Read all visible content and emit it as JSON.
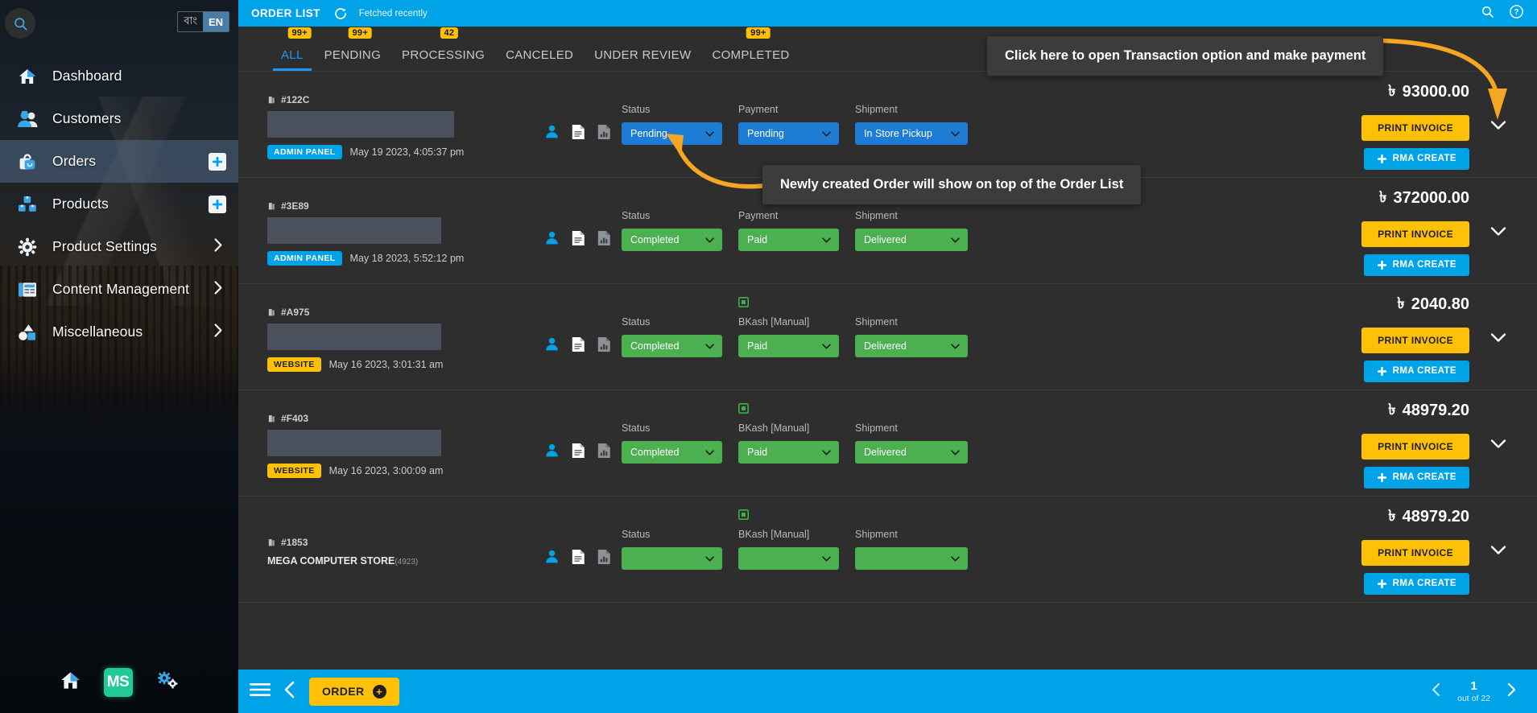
{
  "sidebar": {
    "search_icon": "search-icon",
    "lang": {
      "bn": "বাং",
      "en": "EN",
      "active": "EN"
    },
    "items": [
      {
        "label": "Dashboard",
        "icon": "home-icon",
        "active": false,
        "affix": "none"
      },
      {
        "label": "Customers",
        "icon": "users-icon",
        "active": false,
        "affix": "none"
      },
      {
        "label": "Orders",
        "icon": "bag-icon",
        "active": true,
        "affix": "plus"
      },
      {
        "label": "Products",
        "icon": "boxes-icon",
        "active": false,
        "affix": "plus"
      },
      {
        "label": "Product Settings",
        "icon": "gear-icon",
        "active": false,
        "affix": "chevron"
      },
      {
        "label": "Content Management",
        "icon": "newspaper-icon",
        "active": false,
        "affix": "chevron"
      },
      {
        "label": "Miscellaneous",
        "icon": "shapes-icon",
        "active": false,
        "affix": "chevron"
      }
    ],
    "footer": {
      "home_icon": "home-icon",
      "logo_text": "MS",
      "settings_icon": "gears-icon"
    }
  },
  "topbar": {
    "title": "ORDER LIST",
    "refresh_icon": "refresh-icon",
    "fetched": "Fetched recently",
    "search_icon": "search-icon",
    "help_icon": "help-circle-icon",
    "accent": "#00a3e8"
  },
  "tabs": [
    {
      "label": "ALL",
      "badge": "99+",
      "active": true
    },
    {
      "label": "PENDING",
      "badge": "99+",
      "active": false
    },
    {
      "label": "PROCESSING",
      "badge": "42",
      "active": false
    },
    {
      "label": "CANCELED",
      "badge": "",
      "active": false
    },
    {
      "label": "UNDER REVIEW",
      "badge": "",
      "active": false
    },
    {
      "label": "COMPLETED",
      "badge": "99+",
      "active": false
    }
  ],
  "labels": {
    "status": "Status",
    "payment": "Payment",
    "shipment": "Shipment",
    "bkash_manual": "BKash [Manual]",
    "print_invoice": "PRINT INVOICE",
    "rma_create": "RMA CREATE",
    "taka": "৳"
  },
  "orders": [
    {
      "id": "#122C",
      "redacted_width": 232,
      "source": "ADMIN PANEL",
      "source_type": "admin",
      "timestamp": "May 19 2023, 4:05:37 pm",
      "status": "Pending",
      "status_color": "blue",
      "payment_label": "Payment",
      "payment": "Pending",
      "payment_color": "blue",
      "payment_icon": false,
      "shipment": "In Store Pickup",
      "shipment_color": "blue",
      "amount": "93000.00",
      "store": "",
      "store_sub": ""
    },
    {
      "id": "#3E89",
      "redacted_width": 216,
      "source": "ADMIN PANEL",
      "source_type": "admin",
      "timestamp": "May 18 2023, 5:52:12 pm",
      "status": "Completed",
      "status_color": "green",
      "payment_label": "Payment",
      "payment": "Paid",
      "payment_color": "green",
      "payment_icon": false,
      "shipment": "Delivered",
      "shipment_color": "green",
      "amount": "372000.00",
      "store": "",
      "store_sub": ""
    },
    {
      "id": "#A975",
      "redacted_width": 216,
      "source": "WEBSITE",
      "source_type": "web",
      "timestamp": "May 16 2023, 3:01:31 am",
      "status": "Completed",
      "status_color": "green",
      "payment_label": "BKash [Manual]",
      "payment": "Paid",
      "payment_color": "green",
      "payment_icon": true,
      "shipment": "Delivered",
      "shipment_color": "green",
      "amount": "2040.80",
      "store": "",
      "store_sub": ""
    },
    {
      "id": "#F403",
      "redacted_width": 216,
      "source": "WEBSITE",
      "source_type": "web",
      "timestamp": "May 16 2023, 3:00:09 am",
      "status": "Completed",
      "status_color": "green",
      "payment_label": "BKash [Manual]",
      "payment": "Paid",
      "payment_color": "green",
      "payment_icon": true,
      "shipment": "Delivered",
      "shipment_color": "green",
      "amount": "48979.20",
      "store": "",
      "store_sub": ""
    },
    {
      "id": "#1853",
      "redacted_width": 0,
      "source": "",
      "source_type": "none",
      "timestamp": "",
      "status": "",
      "status_color": "green",
      "payment_label": "BKash [Manual]",
      "payment": "",
      "payment_color": "green",
      "payment_icon": true,
      "shipment": "",
      "shipment_color": "green",
      "amount": "48979.20",
      "store": "MEGA COMPUTER STORE",
      "store_sub": "(4923)"
    }
  ],
  "annotations": [
    {
      "id": "txn",
      "text": "Click here to open Transaction option and make payment"
    },
    {
      "id": "new",
      "text": "Newly created Order will show on top of the Order List"
    }
  ],
  "bottombar": {
    "menu_icon": "hamburger-icon",
    "back_icon": "chevron-left-icon",
    "order_label": "ORDER",
    "prev_icon": "chevron-left-icon",
    "next_icon": "chevron-right-icon",
    "page_current": "1",
    "page_out_of": "out of 22"
  }
}
